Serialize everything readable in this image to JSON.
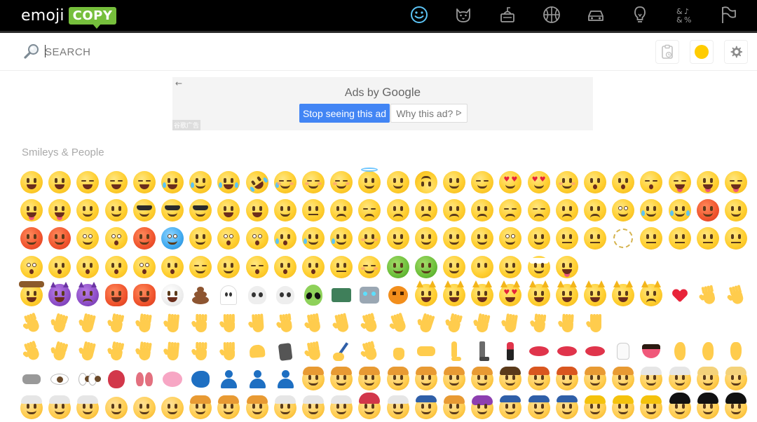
{
  "header": {
    "logo_text": "emoji",
    "logo_badge": "COPY",
    "categories": [
      {
        "name": "smileys",
        "icon": "smiley-icon",
        "active": true
      },
      {
        "name": "animals",
        "icon": "cat-icon",
        "active": false
      },
      {
        "name": "food",
        "icon": "food-icon",
        "active": false
      },
      {
        "name": "activities",
        "icon": "basketball-icon",
        "active": false
      },
      {
        "name": "travel",
        "icon": "car-icon",
        "active": false
      },
      {
        "name": "objects",
        "icon": "lightbulb-icon",
        "active": false
      },
      {
        "name": "symbols",
        "icon": "symbols-icon",
        "active": false
      },
      {
        "name": "flags",
        "icon": "flag-icon",
        "active": false
      }
    ],
    "colors": {
      "bar": "#000000",
      "accent": "#5cc4f5",
      "badge": "#76bf3c"
    }
  },
  "search": {
    "placeholder": "SEARCH",
    "value": ""
  },
  "toolbar": {
    "clipboard_icon": "clipboard-icon",
    "skin_tone_icon": "skin-tone-icon",
    "skin_tone_color": "#ffcc00",
    "settings_icon": "gear-icon"
  },
  "ad": {
    "back_glyph": "←",
    "title_prefix": "Ads by",
    "title_brand": "Google",
    "stop_label": "Stop seeing this ad",
    "why_label": "Why this ad?",
    "why_glyph": "ᐅ",
    "tag": "谷歌广告"
  },
  "section": {
    "title": "Smileys & People"
  },
  "emoji_rows": [
    [
      "grin",
      "grinning",
      "smile",
      "beam",
      "laughing",
      "sweat-smile",
      "sweat",
      "joy",
      "rofl",
      "smiling-tear",
      "relaxed",
      "blush",
      "innocent",
      "slight-smile",
      "upside-down",
      "wink",
      "relieved",
      "heart-eyes",
      "hearts",
      "kissing-heart",
      "kissing",
      "kissing-smiling",
      "kissing-closed",
      "yum",
      "tongue",
      "squint-tongue"
    ],
    [
      "wink-tongue",
      "zany",
      "raised-eyebrow",
      "monocle",
      "nerd",
      "sunglasses",
      "disguised",
      "star-struck",
      "partying",
      "smirk",
      "unamused",
      "disappointed",
      "pensive",
      "worried",
      "confused",
      "slight-frown",
      "frowning",
      "persevere",
      "confounded",
      "tired",
      "weary",
      "pleading",
      "cry",
      "sob",
      "triumph",
      "angry"
    ],
    [
      "rage",
      "cursing",
      "exploding",
      "flushed",
      "hot",
      "cold",
      "face-in-clouds",
      "scream",
      "fearful",
      "cold-sweat",
      "disappointed-relieved",
      "sweat-face",
      "hugging",
      "thinking",
      "hand-over-mouth",
      "yawning",
      "shushing",
      "peeking",
      "saluting",
      "lying",
      "no-mouth",
      "dotted-line",
      "neutral",
      "expressionless",
      "grimacing",
      "rolling-eyes"
    ],
    [
      "hushed",
      "frowning-open",
      "anguished",
      "open-mouth",
      "astonished",
      "yawn",
      "sleeping",
      "drooling",
      "sleepy",
      "dizzy",
      "spiral",
      "zipper",
      "woozy",
      "nauseated",
      "vomiting",
      "sneezing",
      "mask",
      "thermometer",
      "bandage",
      "money-mouth"
    ],
    [
      "cowboy",
      "smiling-imp",
      "imp",
      "ogre",
      "goblin",
      "clown",
      "poop",
      "ghost",
      "skull",
      "crossbones",
      "alien",
      "invader",
      "robot",
      "jack-o-lantern",
      "smiley-cat",
      "smile-cat",
      "joy-cat",
      "heart-eyes-cat",
      "smirk-cat",
      "kissing-cat",
      "scream-cat",
      "crying-cat",
      "pouting-cat",
      "heart-hands",
      "palms-up",
      "open-hands"
    ],
    [
      "raised-hands",
      "clap",
      "handshake",
      "thumbsup",
      "thumbsdown",
      "fist",
      "left-fist",
      "right-fist",
      "crossed-fingers",
      "v",
      "love-you",
      "metal",
      "ok-hand",
      "pinched",
      "pinching",
      "point-left",
      "point-right",
      "point-up",
      "point-down",
      "point-up-2",
      "index-point"
    ],
    [
      "raised-hand",
      "back-hand",
      "hand-splayed",
      "vulcan",
      "wave",
      "call-me",
      "leftwards",
      "rightwards",
      "muscle",
      "mech-arm",
      "middle-finger",
      "writing-hand",
      "pray",
      "fist-bump",
      "foot",
      "leg",
      "mech-leg",
      "lipstick",
      "kiss-mark",
      "lips",
      "biting-lip",
      "tooth",
      "tongue-out",
      "ear",
      "hearing-aid",
      "nose"
    ],
    [
      "footprints",
      "eye",
      "eyes",
      "anatomical-heart",
      "lungs",
      "brain",
      "speaking-head",
      "bust",
      "busts",
      "people-hugging",
      "baby",
      "child",
      "girl",
      "boy",
      "person",
      "man",
      "woman",
      "man-beard",
      "woman-red",
      "man-red",
      "woman-curly",
      "man-curly",
      "woman-white",
      "man-white",
      "blond-woman",
      "blond-man"
    ],
    [
      "old-man",
      "old-woman",
      "older-person",
      "bald-woman",
      "bald-man",
      "bald-person",
      "person-2",
      "woman-2",
      "man-2",
      "older-woman",
      "older-adult",
      "old-bald",
      "guard-red",
      "person-chef",
      "turban",
      "person-bun",
      "hijab",
      "police",
      "police-woman",
      "police-man",
      "construction",
      "construction-2",
      "construction-3",
      "guard",
      "guard-2",
      "guard-3"
    ]
  ]
}
